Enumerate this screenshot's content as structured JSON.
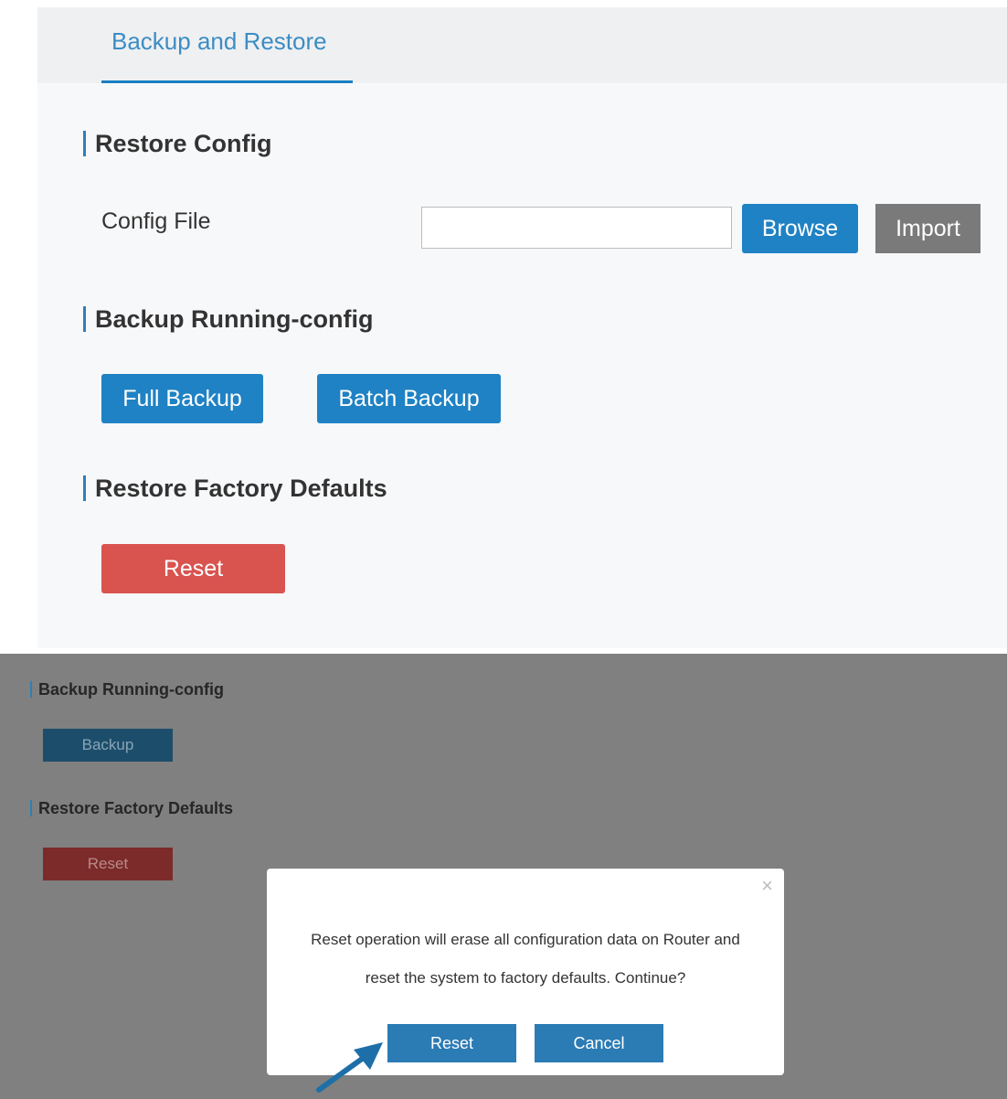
{
  "tabs": [
    {
      "label": "Backup and Restore",
      "active": true
    }
  ],
  "restore_config": {
    "title": "Restore Config",
    "field_label": "Config File",
    "field_value": "",
    "browse_label": "Browse",
    "import_label": "Import"
  },
  "backup_running": {
    "title": "Backup Running-config",
    "full_backup_label": "Full Backup",
    "batch_backup_label": "Batch Backup"
  },
  "factory_defaults": {
    "title": "Restore Factory Defaults",
    "reset_label": "Reset"
  },
  "background": {
    "backup_title": "Backup Running-config",
    "backup_label": "Backup",
    "factory_title": "Restore Factory Defaults",
    "reset_label": "Reset"
  },
  "modal": {
    "close_glyph": "×",
    "message_line1": "Reset operation will erase all configuration data on Router and",
    "message_line2": "reset the system to factory defaults. Continue?",
    "confirm_label": "Reset",
    "cancel_label": "Cancel"
  },
  "icons": {
    "close": "close-icon",
    "pointer": "arrow-pointer-icon"
  },
  "colors": {
    "primary": "#1f82c4",
    "danger": "#d9534f",
    "neutral": "#7a7a7a",
    "accent_bar": "#2e7fb8",
    "overlay": "#7f807f"
  }
}
